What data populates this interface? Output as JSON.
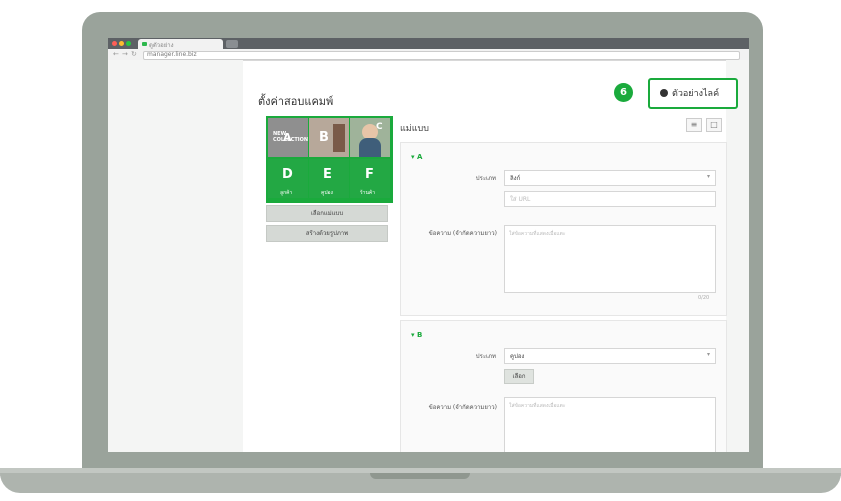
{
  "browser": {
    "tab_title": "ดูตัวอย่าง",
    "url": "manager.line.biz",
    "back_icon": "arrow-left-icon",
    "forward_icon": "arrow-right-icon",
    "reload_icon": "reload-icon"
  },
  "page": {
    "title": "ตั้งค่าสอบแคมพ์",
    "section_label": "แม่แบบ",
    "step_badge": "6",
    "preview_button": "ตัวอย่างไลค์"
  },
  "thumbnails": [
    {
      "letter": "A",
      "caption": "NEW COLLECTION"
    },
    {
      "letter": "B",
      "caption": ""
    },
    {
      "letter": "C",
      "caption": ""
    },
    {
      "letter": "D",
      "caption": "ลูกค้า"
    },
    {
      "letter": "E",
      "caption": "คูปอง"
    },
    {
      "letter": "F",
      "caption": "ร้านค้า"
    }
  ],
  "left_buttons": {
    "select_template": "เลือกแม่แบบ",
    "create_from_image": "สร้างด้วยรูปภาพ"
  },
  "view_toggle": {
    "list_icon": "list-icon",
    "grid_icon": "grid-icon"
  },
  "cards": [
    {
      "header": "▾ A",
      "type_label": "ประเภท",
      "type_value": "ลิงก์",
      "url_placeholder": "ใส่ URL",
      "text_label": "ข้อความ (จำกัดความยาว)",
      "text_placeholder": "ใส่ข้อความที่แสดงเมื่อแตะ",
      "counter": "0/20"
    },
    {
      "header": "▾ B",
      "type_label": "ประเภท",
      "type_value": "คูปอง",
      "select_button": "เลือก",
      "text_label": "ข้อความ (จำกัดความยาว)",
      "text_placeholder": "ใส่ข้อความที่แสดงเมื่อแตะ"
    }
  ],
  "colors": {
    "accent": "#1aaa3c",
    "laptop": "#9aa39b"
  }
}
